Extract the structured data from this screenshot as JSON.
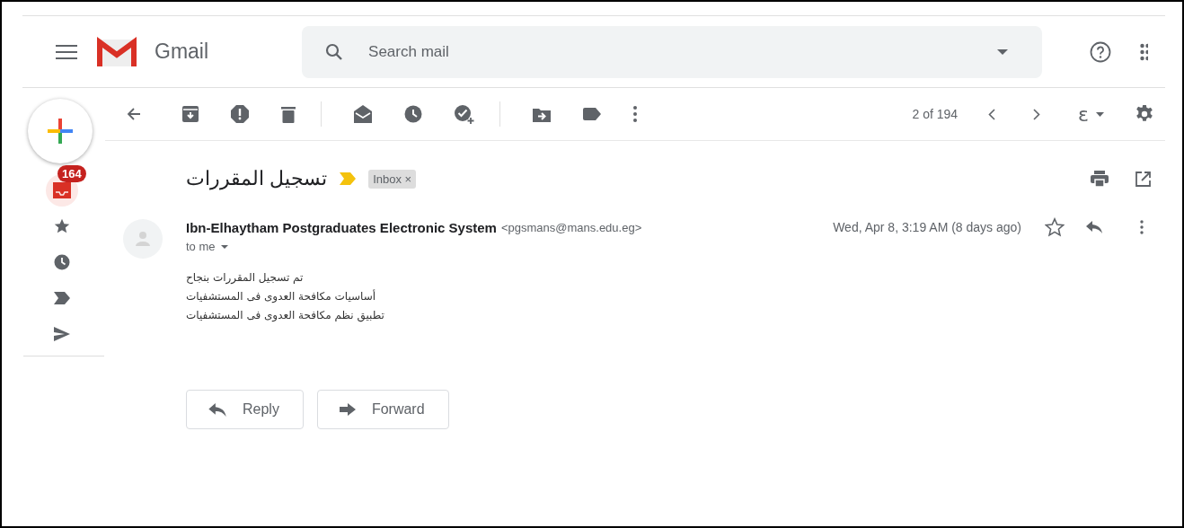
{
  "header": {
    "app_name": "Gmail",
    "search": {
      "placeholder": "Search mail"
    }
  },
  "toolbar": {
    "pagination": "2 of 194",
    "input_tool": "ε"
  },
  "sidebar": {
    "items": [
      {
        "kind": "inbox",
        "selected": true,
        "badge": "164"
      },
      {
        "kind": "starred",
        "selected": false
      },
      {
        "kind": "snoozed",
        "selected": false
      },
      {
        "kind": "important",
        "selected": false
      },
      {
        "kind": "sent",
        "selected": false
      }
    ]
  },
  "thread": {
    "subject": "تسجيل المقررات",
    "labels": [
      {
        "text": "Inbox",
        "remove": "×"
      }
    ]
  },
  "message": {
    "sender_name": "Ibn-Elhaytham Postgraduates Electronic System",
    "sender_email": "<pgsmans@mans.edu.eg>",
    "recipient": "to me",
    "date": "Wed, Apr 8, 3:19 AM (8 days ago)",
    "starred": false,
    "body": [
      "تم تسجيل المقررات بنجاح",
      "أساسيات مكافحة العدوى فى المستشفيات",
      "تطبيق نظم مكافحة العدوى فى المستشفيات"
    ]
  },
  "actions": [
    {
      "kind": "reply",
      "label": "Reply"
    },
    {
      "kind": "forward",
      "label": "Forward"
    }
  ]
}
